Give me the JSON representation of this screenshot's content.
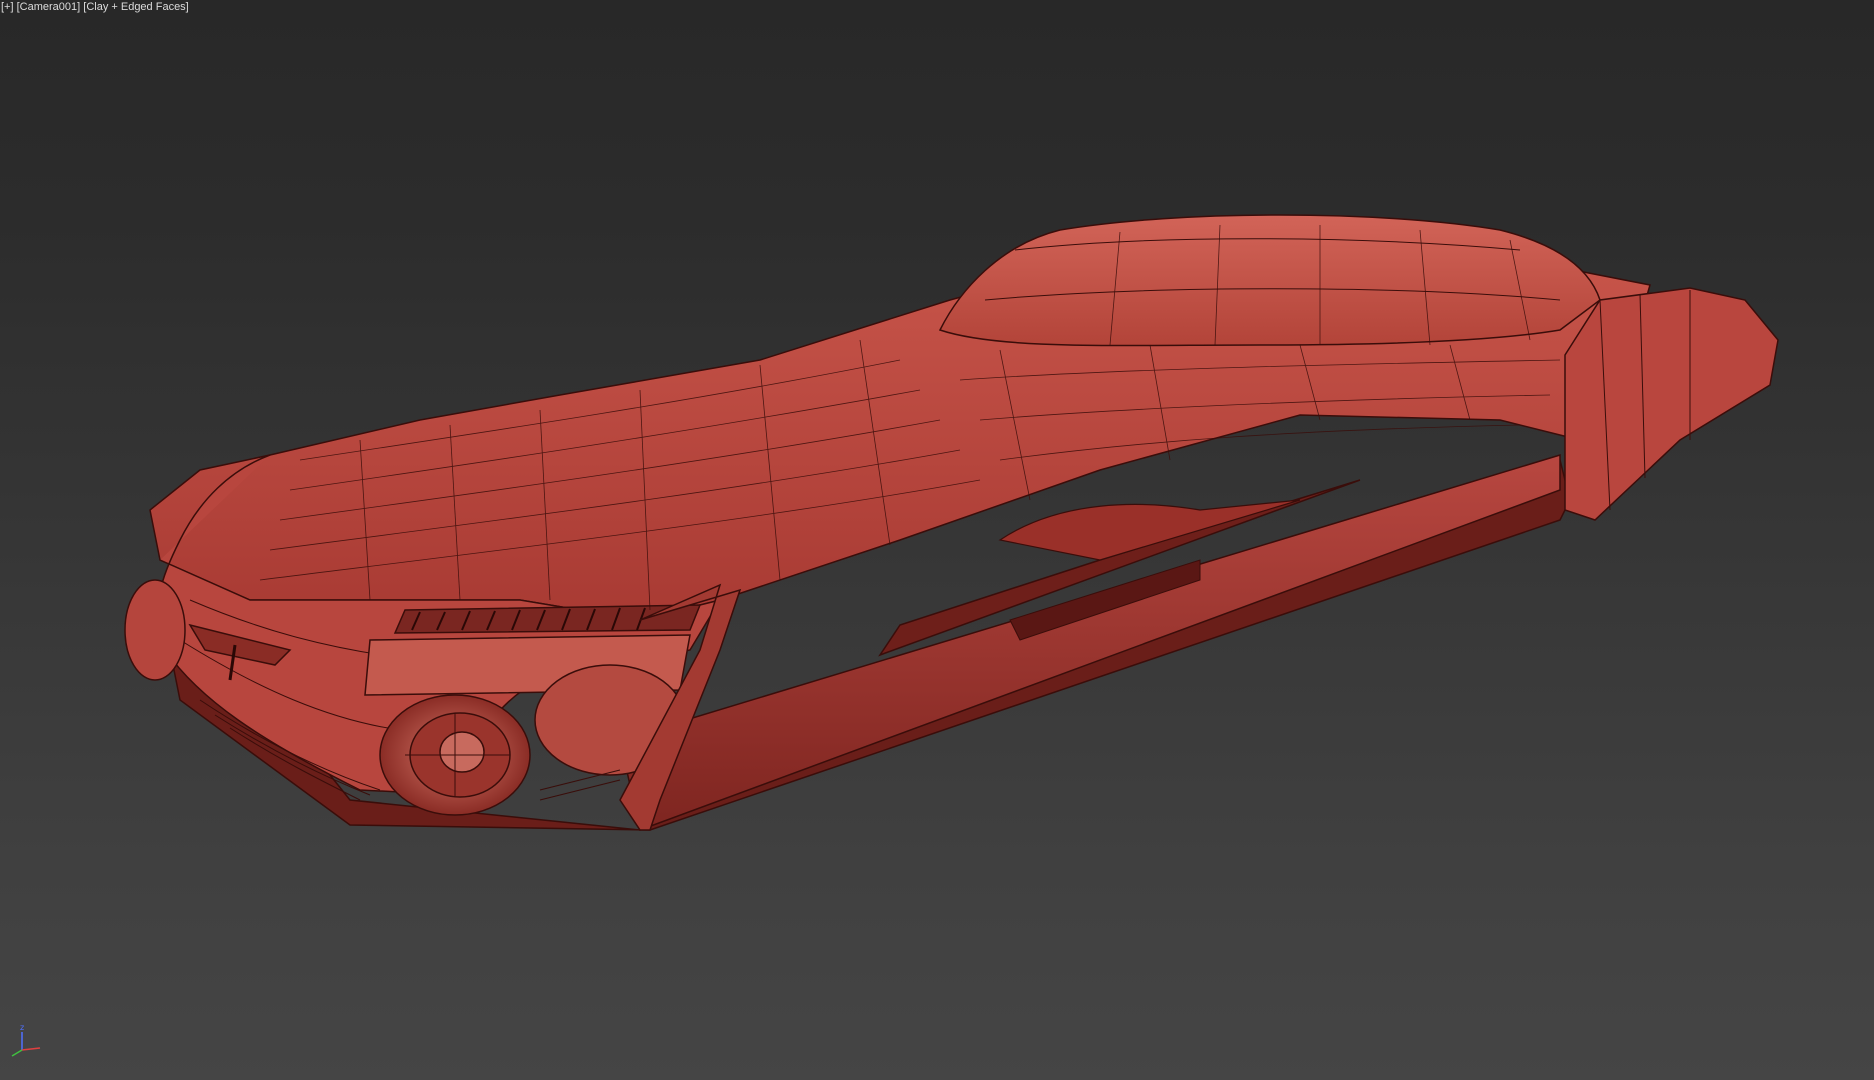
{
  "viewport": {
    "menu_label": "[+]",
    "camera_label": "[Camera001]",
    "shading_label": "[Clay + Edged Faces]"
  },
  "axis_gizmo": {
    "z_label": "z",
    "colors": {
      "x": "#e04040",
      "y": "#40c040",
      "z": "#5070ff"
    }
  },
  "model": {
    "name": "hover-car-clay-model",
    "clay_color": "#b8443c",
    "highlight_color": "#d86a5c",
    "edge_color": "#3a0d0a",
    "shadow_color": "#6e1f1a"
  }
}
